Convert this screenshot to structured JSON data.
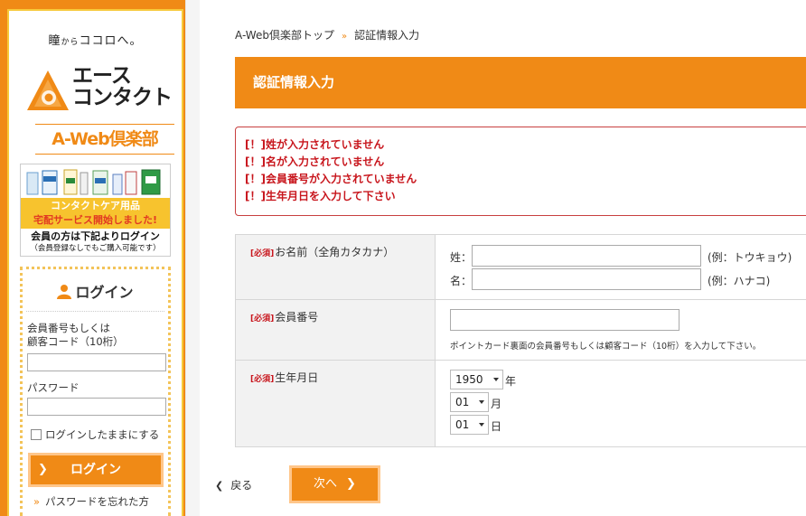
{
  "sidebar": {
    "tagline_a": "瞳",
    "tagline_b": "から",
    "tagline_c": "ココロへ。",
    "logo_line1": "エース",
    "logo_line2": "コンタクト",
    "club_title": "A-Web倶楽部",
    "promo_line1": "コンタクトケア用品",
    "promo_line2": "宅配サービス開始しました!",
    "promo_members": "会員の方は下記よりログイン",
    "promo_note": "（会員登録なしでもご購入可能です）",
    "login_heading": "ログイン",
    "member_label_1": "会員番号もしくは",
    "member_label_2": "顧客コード（10桁）",
    "member_value": "",
    "password_label": "パスワード",
    "password_value": "",
    "keep_login_label": "ログインしたままにする",
    "login_button": "ログイン",
    "forgot_link": "パスワードを忘れた方"
  },
  "breadcrumb": {
    "home": "A-Web倶楽部トップ",
    "separator": "»",
    "current": "認証情報入力"
  },
  "page_title": "認証情報入力",
  "errors": [
    "[！]姓が入力されていません",
    "[！]名が入力されていません",
    "[！]会員番号が入力されていません",
    "[！]生年月日を入力して下さい"
  ],
  "form": {
    "required_tag": "[必須]",
    "name_label": "お名前（全角カタカナ）",
    "sei_label": "姓：",
    "sei_value": "",
    "sei_example": "(例：トウキョウ)",
    "mei_label": "名：",
    "mei_value": "",
    "mei_example": "(例：ハナコ)",
    "member_no_label": "会員番号",
    "member_no_value": "",
    "member_no_note": "ポイントカード裏面の会員番号もしくは顧客コード（10桁）を入力して下さい。",
    "dob_label": "生年月日",
    "year_value": "1950",
    "year_unit": "年",
    "month_value": "01",
    "month_unit": "月",
    "day_value": "01",
    "day_unit": "日"
  },
  "actions": {
    "back_label": "戻る",
    "next_label": "次へ"
  },
  "colors": {
    "brand_orange": "#f08a16",
    "error_red": "#c8161d",
    "promo_yellow": "#f7c32e"
  }
}
